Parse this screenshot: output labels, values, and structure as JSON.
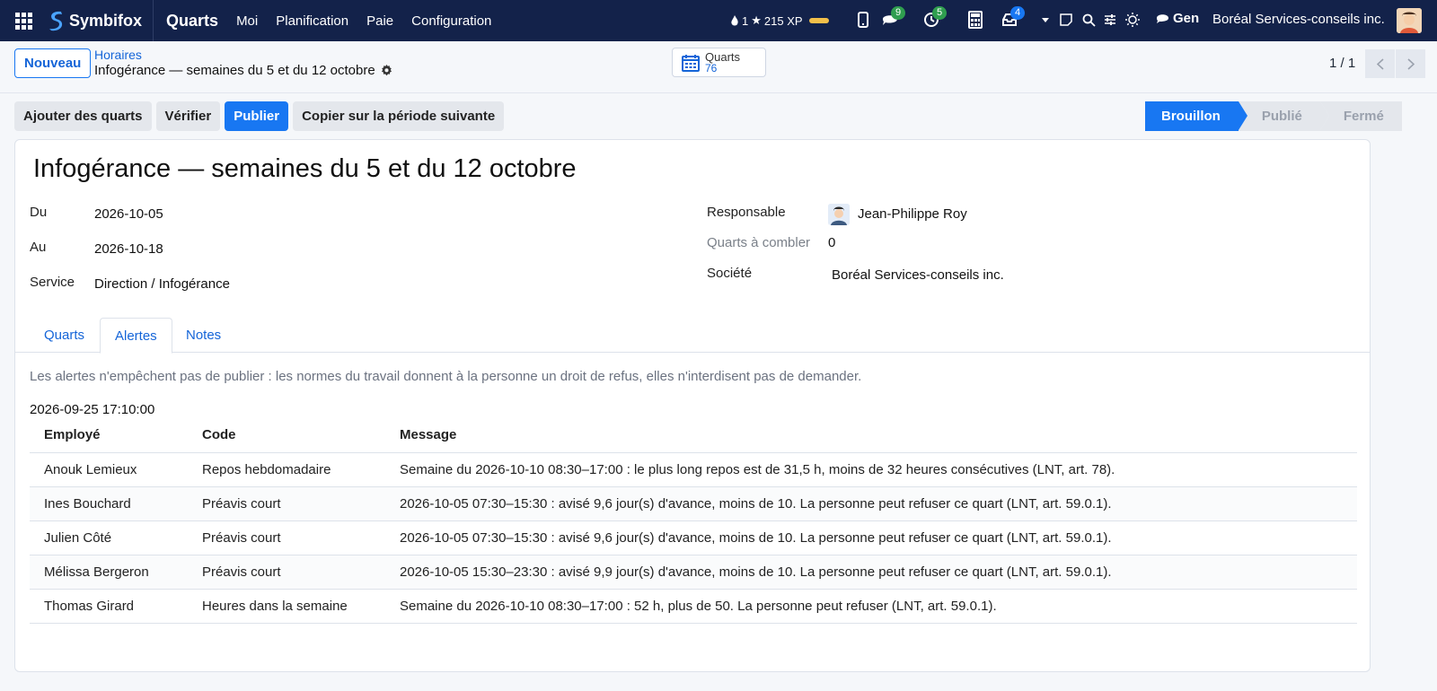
{
  "navbar": {
    "brand": "Symbifox",
    "app": "Quarts",
    "menu": [
      "Moi",
      "Planification",
      "Paie",
      "Configuration"
    ],
    "streak": "1",
    "xp": "215 XP",
    "chat_count": "9",
    "activity_count": "5",
    "mail_count": "4",
    "gen_label": "Gen",
    "company": "Boréal Services-conseils inc.",
    "colors": {
      "navbar_bg": "#13224a",
      "accent": "#1877f2",
      "badge_green": "#2f9e4f"
    }
  },
  "control": {
    "new_button": "Nouveau",
    "breadcrumb_parent": "Horaires",
    "breadcrumb_current": "Infogérance — semaines du 5 et du 12 octobre",
    "smart_button": {
      "label": "Quarts",
      "value": "76"
    },
    "pager": "1 / 1"
  },
  "actions": {
    "add_shifts": "Ajouter des quarts",
    "verify": "Vérifier",
    "publish": "Publier",
    "copy_next": "Copier sur la période suivante"
  },
  "status": {
    "steps": [
      "Brouillon",
      "Publié",
      "Fermé"
    ],
    "active": "Brouillon"
  },
  "form": {
    "title": "Infogérance — semaines du 5 et du 12 octobre",
    "from_label": "Du",
    "from_value": "2026-10-05",
    "to_label": "Au",
    "to_value": "2026-10-18",
    "service_label": "Service",
    "service_value": "Direction / Infogérance",
    "manager_label": "Responsable",
    "manager_value": "Jean-Philippe Roy",
    "open_shifts_label": "Quarts à combler",
    "open_shifts_value": "0",
    "company_label": "Société",
    "company_value": "Boréal Services-conseils inc."
  },
  "tabs": [
    "Quarts",
    "Alertes",
    "Notes"
  ],
  "active_tab": "Alertes",
  "alerts": {
    "notice": "Les alertes n'empêchent pas de publier : les normes du travail donnent à la personne un droit de refus, elles n'interdisent pas de demander.",
    "timestamp": "2026-09-25 17:10:00",
    "columns": [
      "Employé",
      "Code",
      "Message"
    ],
    "rows": [
      [
        "Anouk Lemieux",
        "Repos hebdomadaire",
        "Semaine du 2026-10-10 08:30–17:00 : le plus long repos est de 31,5 h, moins de 32 heures consécutives (LNT, art. 78)."
      ],
      [
        "Ines Bouchard",
        "Préavis court",
        "2026-10-05 07:30–15:30 : avisé 9,6 jour(s) d'avance, moins de 10. La personne peut refuser ce quart (LNT, art. 59.0.1)."
      ],
      [
        "Julien Côté",
        "Préavis court",
        "2026-10-05 07:30–15:30 : avisé 9,6 jour(s) d'avance, moins de 10. La personne peut refuser ce quart (LNT, art. 59.0.1)."
      ],
      [
        "Mélissa Bergeron",
        "Préavis court",
        "2026-10-05 15:30–23:30 : avisé 9,9 jour(s) d'avance, moins de 10. La personne peut refuser ce quart (LNT, art. 59.0.1)."
      ],
      [
        "Thomas Girard",
        "Heures dans la semaine",
        "Semaine du 2026-10-10 08:30–17:00 : 52 h, plus de 50. La personne peut refuser (LNT, art. 59.0.1)."
      ]
    ]
  },
  "icons": {
    "apps": "grid-icon",
    "brand": "symbifox-logo-icon",
    "streak": "flame-icon",
    "xp": "star-icon",
    "phone": "phone-icon",
    "chat": "chat-icon",
    "activity": "clock-check-icon",
    "calculator": "calculator-icon",
    "mail": "inbox-icon",
    "settings": "gear-icon",
    "calendar": "calendar-icon"
  }
}
